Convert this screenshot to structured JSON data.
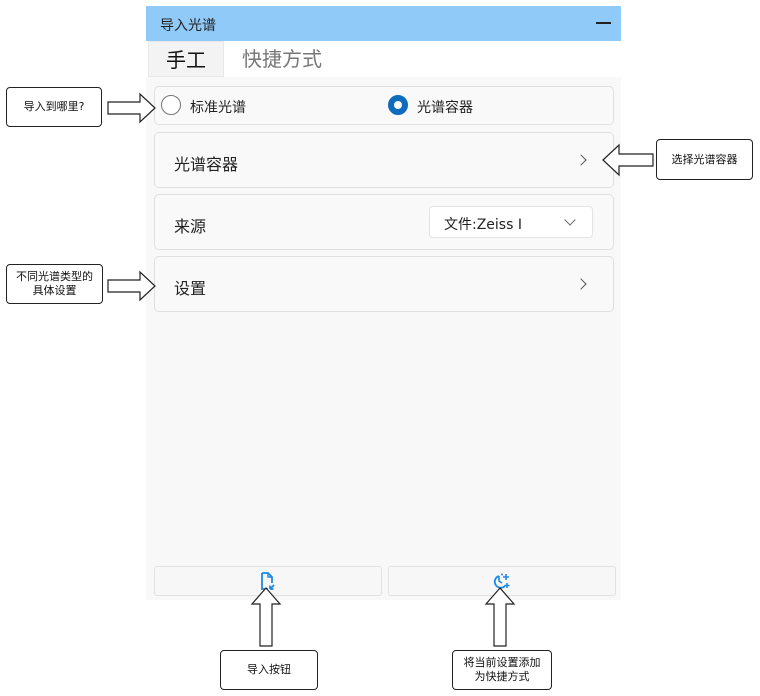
{
  "window": {
    "title": "导入光谱"
  },
  "tabs": [
    {
      "label": "手工",
      "active": true
    },
    {
      "label": "快捷方式",
      "active": false
    }
  ],
  "destination": {
    "options": [
      {
        "label": "标准光谱",
        "selected": false
      },
      {
        "label": "光谱容器",
        "selected": true
      }
    ]
  },
  "rows": {
    "container_label": "光谱容器",
    "source_label": "来源",
    "source_value": "文件:Zeiss I",
    "settings_label": "设置"
  },
  "buttons": {
    "import_icon": "import-file-icon",
    "add_shortcut_icon": "add-shortcut-icon"
  },
  "annotations": {
    "where_to_import": "导入到哪里?",
    "select_container": "选择光谱容器",
    "type_settings_line1": "不同光谱类型的",
    "type_settings_line2": "具体设置",
    "import_button": "导入按钮",
    "add_shortcut_line1": "将当前设置添加",
    "add_shortcut_line2": "为快捷方式"
  },
  "colors": {
    "titlebar": "#90caf9",
    "accent": "#0f6cbd",
    "icon_blue": "#1e88e5"
  }
}
